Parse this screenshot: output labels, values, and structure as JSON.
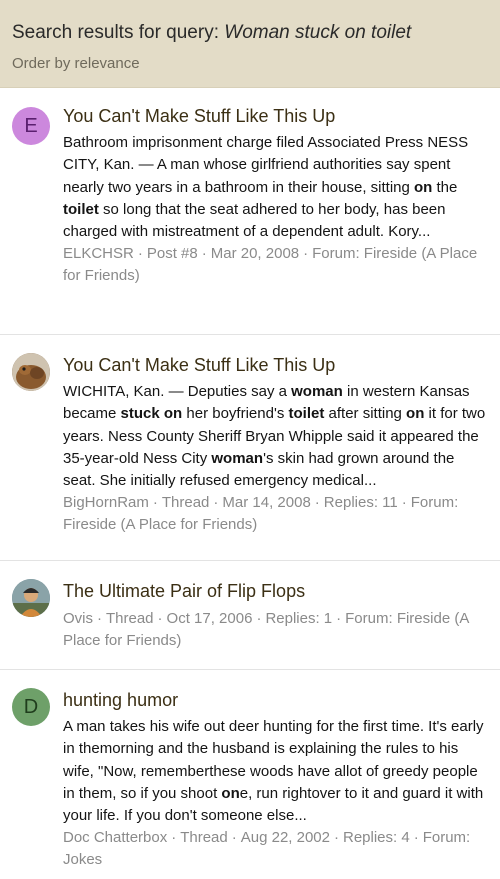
{
  "header": {
    "title_prefix": "Search results for query: ",
    "query": "Woman stuck on toilet",
    "order": "Order by relevance"
  },
  "results": [
    {
      "avatar_letter": "E",
      "avatar_color": "#cc88dd",
      "title": "You Can't Make Stuff Like This Up",
      "snippet_html": "Bathroom imprisonment charge filed Associated Press NESS CITY, Kan. — A man whose girlfriend authorities say spent nearly two years in a bathroom in their house, sitting <b>on</b> the <b>toilet</b> so long that the seat adhered to her body, has been charged with mistreatment of a dependent adult. Kory...",
      "author": "ELKCHSR",
      "type": "Post #8",
      "date": "Mar 20, 2008",
      "replies": "",
      "forum": "Forum: Fireside (A Place for Friends)"
    },
    {
      "avatar_letter": "",
      "avatar_color": "#7a5a3a",
      "title": "You Can't Make Stuff Like This Up",
      "snippet_html": "WICHITA, Kan. — Deputies say a <b>woman</b> in western Kansas became <b>stuck on</b> her boyfriend's <b>toilet</b> after sitting <b>on</b> it for two years. Ness County Sheriff Bryan Whipple said it appeared the 35-year-old Ness City <b>woman</b>'s skin had grown around the seat. She initially refused emergency medical...",
      "author": "BigHornRam",
      "type": "Thread",
      "date": "Mar 14, 2008",
      "replies": "Replies: 11",
      "forum": "Forum: Fireside (A Place for Friends)"
    },
    {
      "avatar_letter": "",
      "avatar_color": "#5b7a8a",
      "title": "The Ultimate Pair of Flip Flops",
      "snippet_html": "",
      "author": "Ovis",
      "type": "Thread",
      "date": "Oct 17, 2006",
      "replies": "Replies: 1",
      "forum": "Forum: Fireside (A Place for Friends)"
    },
    {
      "avatar_letter": "D",
      "avatar_color": "#6ea069",
      "title": "hunting humor",
      "snippet_html": "A man takes his wife out deer hunting for the first time. It's early in themorning and the husband is explaining the rules to his wife, \"Now, rememberthese woods have allot of greedy people in them, so if you shoot <b>on</b>e, run rightover to it and guard it with your life. If you don't someone else...",
      "author": "Doc Chatterbox",
      "type": "Thread",
      "date": "Aug 22, 2002",
      "replies": "Replies: 4",
      "forum": "Forum: Jokes"
    }
  ]
}
